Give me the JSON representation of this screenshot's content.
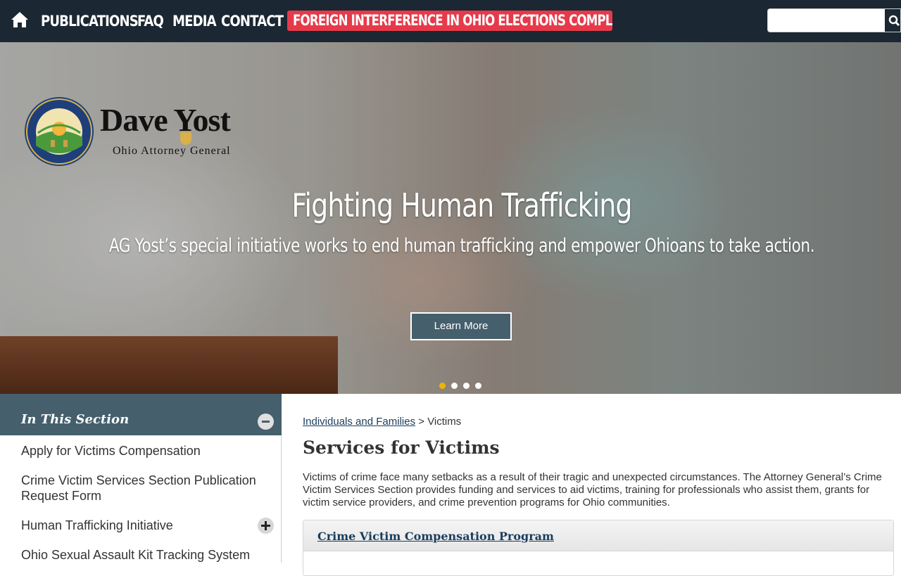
{
  "nav": {
    "home_label": "Home",
    "items": [
      "PUBLICATIONS",
      "FAQ",
      "MEDIA",
      "CONTACT"
    ],
    "alert": "FOREIGN INTERFERENCE IN OHIO ELECTIONS COMPLAINTS",
    "search_value": "",
    "icons": [
      "home-icon",
      "search-icon"
    ]
  },
  "hero": {
    "logo_name": "Dave Yost",
    "logo_subtitle": "Ohio Attorney General",
    "seal_text_outer": "THE SEAL OF THE ATTORNEY GENERAL OF THE STATE OF OHIO",
    "title": "Fighting Human Trafficking",
    "subtitle": "AG Yost’s special initiative works to end human trafficking and empower Ohioans to take action.",
    "button": "Learn More",
    "slides": 4,
    "active_slide": 1,
    "active_dot_color": "#f0b400"
  },
  "sidebar": {
    "title": "In This Section",
    "links": [
      "Apply for Victims Compensation",
      "Crime Victim Services Section Publication Request Form",
      "Human Trafficking Initiative",
      "Ohio Sexual Assault Kit Tracking System"
    ]
  },
  "main": {
    "breadcrumb_link": "Individuals and Families",
    "breadcrumb_sep": ">",
    "breadcrumb_current": "Victims",
    "title": "Services for Victims",
    "intro": "Victims of crime face many setbacks as a result of their tragic and unexpected circumstances. The Attorney General’s Crime Victim Services Section provides funding and services to aid victims, training for professionals who assist them, grants for victim service providers, and crime prevention programs for Ohio communities.",
    "accordion_title": "Crime Victim Compensation Program"
  },
  "colors": {
    "topbar": "#1b2732",
    "alert": "#e63a4a",
    "section_head": "#455f6c",
    "link": "#1a3d5c"
  }
}
